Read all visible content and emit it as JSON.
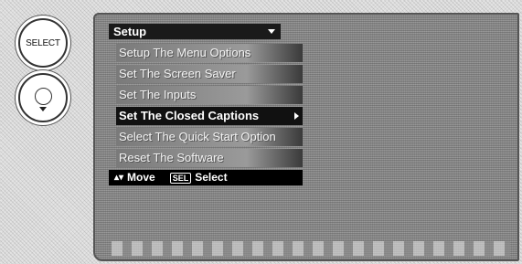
{
  "remote": {
    "select_button_label": "SELECT",
    "down_button_icon": "chevron-down-icon"
  },
  "menu": {
    "title": "Setup",
    "items": [
      {
        "label": "Setup The Menu Options",
        "selected": false
      },
      {
        "label": "Set The Screen Saver",
        "selected": false
      },
      {
        "label": "Set The Inputs",
        "selected": false
      },
      {
        "label": "Set The Closed Captions",
        "selected": true
      },
      {
        "label": "Select The Quick Start Option",
        "selected": false
      },
      {
        "label": "Reset The Software",
        "selected": false
      }
    ],
    "footer": {
      "move_label": "Move",
      "sel_key_label": "SEL",
      "select_label": "Select"
    }
  }
}
